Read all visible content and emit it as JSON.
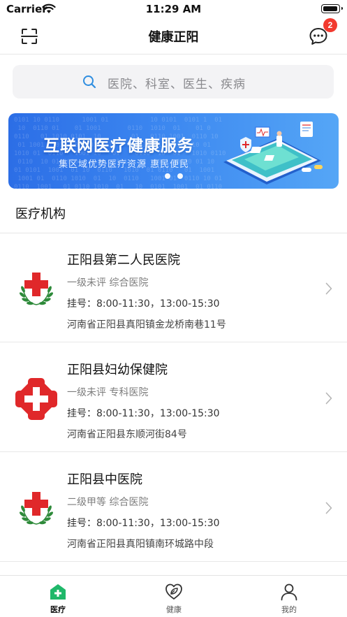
{
  "status_bar": {
    "carrier": "Carrier",
    "time": "11:29 AM"
  },
  "nav": {
    "title": "健康正阳",
    "message_badge": "2"
  },
  "search": {
    "placeholder": "医院、科室、医生、疾病"
  },
  "banner": {
    "title": "互联网医疗健康服务",
    "subtitle": "集区域优势医疗资源 惠民便民",
    "page_count": 2
  },
  "section": {
    "title": "医疗机构"
  },
  "hospitals": [
    {
      "name": "正阳县第二人民医院",
      "level": "一级未评 综合医院",
      "hours": "挂号：8:00-11:30，13:00-15:30",
      "address": "河南省正阳县真阳镇金龙桥南巷11号",
      "logo": "red-cross-wreath-logo"
    },
    {
      "name": "正阳县妇幼保健院",
      "level": "一级未评 专科医院",
      "hours": "挂号：8:00-11:30，13:00-15:30",
      "address": "河南省正阳县东顺河街84号",
      "logo": "red-flower-cross-logo"
    },
    {
      "name": "正阳县中医院",
      "level": "二级甲等 综合医院",
      "hours": "挂号：8:00-11:30，13:00-15:30",
      "address": "河南省正阳县真阳镇南环城路中段",
      "logo": "red-cross-wreath-logo"
    }
  ],
  "tabbar": {
    "items": [
      {
        "label": "医疗",
        "icon": "hospital-house-icon",
        "active": true
      },
      {
        "label": "健康",
        "icon": "heart-leaf-icon",
        "active": false
      },
      {
        "label": "我的",
        "icon": "person-icon",
        "active": false
      }
    ]
  },
  "colors": {
    "accent_green": "#1fb86a",
    "badge_red": "#f23a2f",
    "search_icon_blue": "#2f8ee0",
    "banner_blue": "#2c6ee6",
    "logo_red": "#e0282a",
    "logo_green": "#2e8a3a"
  }
}
